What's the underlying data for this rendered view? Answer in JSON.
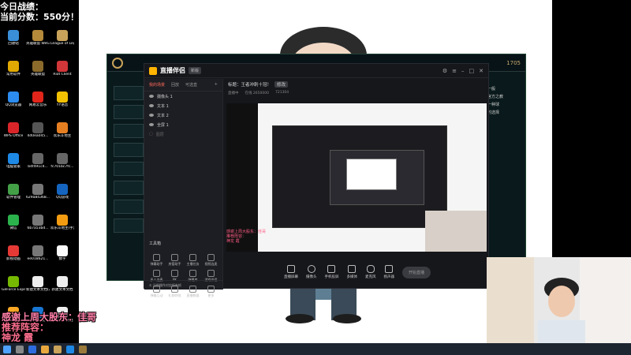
{
  "overlay": {
    "line1": "今日战绩：",
    "line2": "当前分数：550分！",
    "thanks": "感谢上周大股东：佳哥",
    "recommend": "推荐阵容：",
    "lineup": "神龙 霞"
  },
  "desktop_icons": [
    {
      "label": "回收站",
      "color": "#3a8fd8"
    },
    {
      "label": "英雄联盟 WeGame版",
      "color": "#b58a3b"
    },
    {
      "label": "League of Legends...",
      "color": "#c9a35a"
    },
    {
      "label": "常用软件",
      "color": "#e0a800"
    },
    {
      "label": "英雄联盟",
      "color": "#8b6b2b"
    },
    {
      "label": "Riot Client",
      "color": "#d13639"
    },
    {
      "label": "QQ浏览器",
      "color": "#2d8cf0"
    },
    {
      "label": "网易云音乐",
      "color": "#e1251b"
    },
    {
      "label": "YY语音",
      "color": "#f2c100"
    },
    {
      "label": "WPS Office",
      "color": "#d9252a"
    },
    {
      "label": "4d0ea045...",
      "color": "#555555"
    },
    {
      "label": "欢乐斗地主",
      "color": "#e67e22"
    },
    {
      "label": "电脑管家",
      "color": "#1e88e5"
    },
    {
      "label": "b4f491c4...",
      "color": "#666666"
    },
    {
      "label": "fc701bc7fc...",
      "color": "#666666"
    },
    {
      "label": "软件管理",
      "color": "#43a047"
    },
    {
      "label": "629a84368...",
      "color": "#777777"
    },
    {
      "label": "QQ游戏",
      "color": "#1565c0"
    },
    {
      "label": "微信",
      "color": "#2bb24c"
    },
    {
      "label": "6b7a53bd...",
      "color": "#777777"
    },
    {
      "label": "欢乐斗地主(手游电脑版)",
      "color": "#f39c12"
    },
    {
      "label": "影视动画",
      "color": "#e53935"
    },
    {
      "label": "ee018621...",
      "color": "#777777"
    },
    {
      "label": "数字",
      "color": "#fafafa"
    },
    {
      "label": "GeForce Experience",
      "color": "#76b900"
    },
    {
      "label": "新建文本文档(2)",
      "color": "#eeeeee"
    },
    {
      "label": "新建文本文档",
      "color": "#eeeeee"
    },
    {
      "label": "WeGame...",
      "color": "#f9a825"
    },
    {
      "label": "腾讯会议",
      "color": "#1976d2"
    },
    {
      "label": "新建文本文档",
      "color": "#eeeeee"
    }
  ],
  "lol": {
    "coins": "1705",
    "right_chat": [
      "一般",
      "官方之教",
      "一种球",
      "的选择"
    ]
  },
  "stream_app": {
    "name": "直播伴侣",
    "version": "新版",
    "tabs": [
      "我的场景",
      "回放",
      "可选直"
    ],
    "sources": [
      "摄像头 1",
      "文本 1",
      "文本 2",
      "全屏 1",
      "图层"
    ],
    "tools_title": "工具箱",
    "tools": [
      "弹幕助手",
      "房管助手",
      "主播任务",
      "视频连麦",
      "多人连麦",
      "PK",
      "弹幕库",
      "游戏伴侣",
      "弹幕互动",
      "礼物特效",
      "直播数据",
      "更多"
    ],
    "hint": "① 当前操作对应所有帧",
    "room_title": "标题：王者冲刺十冠！",
    "edit_label": "修改",
    "meta": [
      "直播中",
      "在线 2650000",
      "721304"
    ],
    "preview_caption": [
      "感谢上周大股东：佳哥",
      "推荐阵容：",
      "神龙 霞"
    ],
    "controls": [
      "直播屏幕",
      "摄像头",
      "手机投屏",
      "多媒体",
      "麦克风",
      "扬声器"
    ],
    "start_live": "开始直播"
  },
  "colors": {
    "accent": "#ff6a5b",
    "overlay_pink": "#ff7fa8",
    "app_bg": "#16171b"
  }
}
